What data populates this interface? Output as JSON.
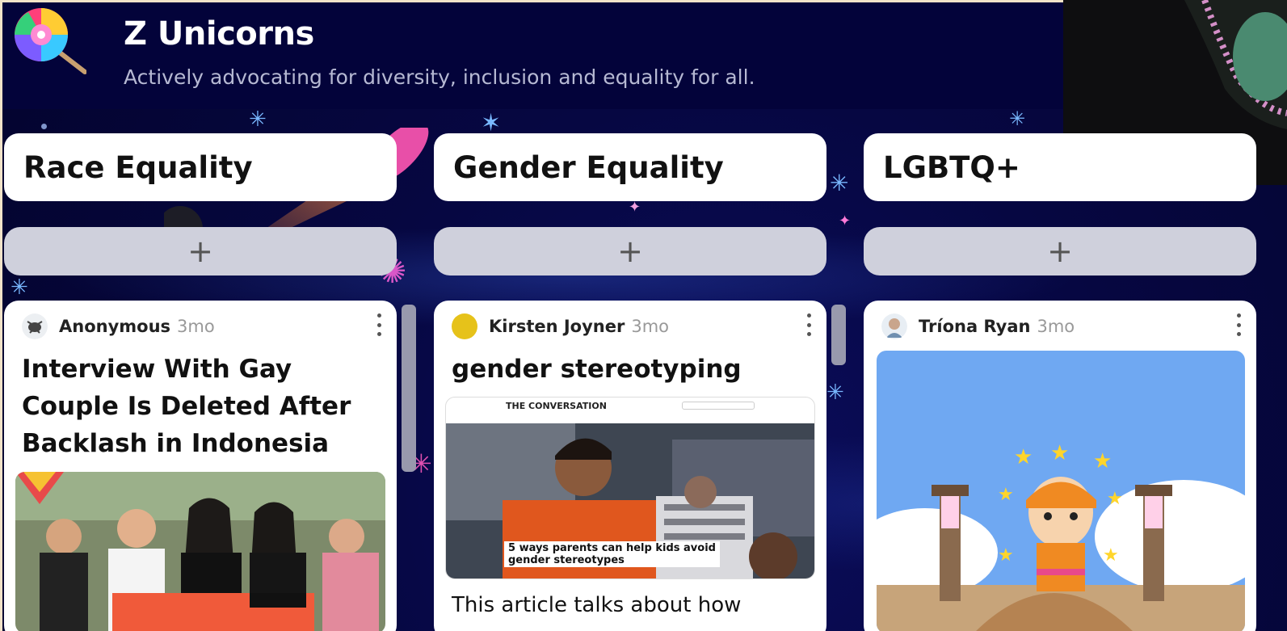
{
  "board": {
    "title": "Z Unicorns",
    "subtitle": "Actively advocating for diversity, inclusion and equality for all."
  },
  "colors": {
    "background": "#050638",
    "card": "#ffffff",
    "add_button": "#cfd0dc"
  },
  "columns": [
    {
      "heading": "Race Equality",
      "add_label": "+",
      "post": {
        "author": "Anonymous",
        "time": "3mo",
        "title": "Interview With Gay Couple Is Deleted After Backlash in Indonesia",
        "image_icon": "protest-photo"
      }
    },
    {
      "heading": "Gender Equality",
      "add_label": "+",
      "post": {
        "author": "Kirsten Joyner",
        "time": "3mo",
        "title": "gender stereotyping",
        "image": {
          "site": "THE CONVERSATION",
          "caption_line1": "5 ways parents can help kids avoid",
          "caption_line2": "gender stereotypes"
        },
        "body": "This article talks about how"
      }
    },
    {
      "heading": "LGBTQ+",
      "add_label": "+",
      "post": {
        "author": "Tríona Ryan",
        "time": "3mo",
        "image_icon": "game-character-illustration"
      }
    }
  ]
}
